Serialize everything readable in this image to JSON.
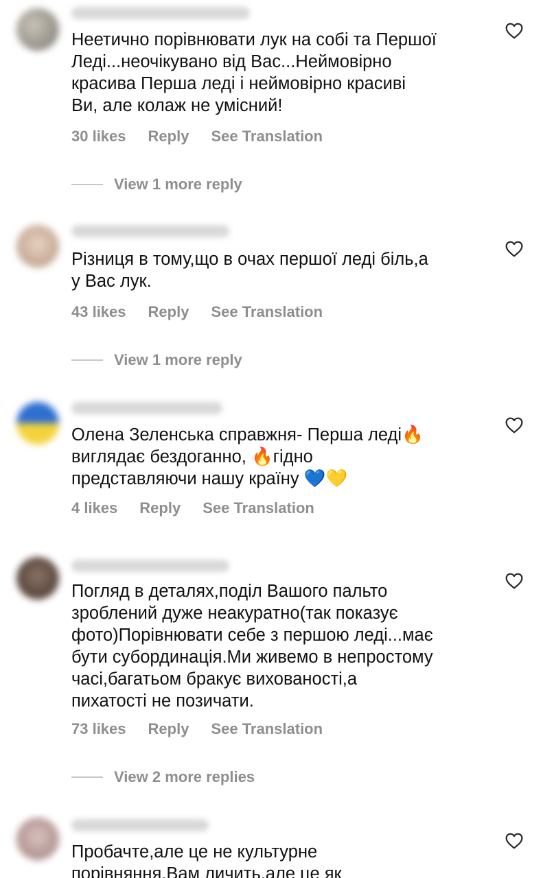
{
  "comments": [
    {
      "lines": [
        "Неетично порівнювати лук на собі та Першої",
        "Леді...неочікувано від Вас...Неймовірно",
        "красива Перша леді і неймовірно красиві",
        "Ви, але колаж не умісний!"
      ],
      "likes": "30 likes",
      "reply": "Reply",
      "translate": "See Translation",
      "more_replies": "View 1 more reply"
    },
    {
      "lines": [
        "Різниця в тому,що в очах першої леді біль,а",
        "у Вас лук."
      ],
      "likes": "43 likes",
      "reply": "Reply",
      "translate": "See Translation",
      "more_replies": "View 1 more reply"
    },
    {
      "lines": [
        "Олена Зеленська  справжня-  Перша леді",
        "виглядає бездоганно, ",
        "гідно",
        "представляючи нашу  країну "
      ],
      "emoji_fire": "🔥",
      "emoji_blue_heart": "💙",
      "emoji_yellow_heart": "💛",
      "likes": "4 likes",
      "reply": "Reply",
      "translate": "See Translation"
    },
    {
      "lines": [
        "Погляд в деталях,поділ Вашого пальто",
        "зроблений дуже неакуратно(так показує",
        "фото)Порівнювати себе з першою леді...має",
        "бути субординація.Ми живемо в непростому",
        "часі,багатьом бракує вихованості,а",
        "пихатості не позичати."
      ],
      "likes": "73 likes",
      "reply": "Reply",
      "translate": "See Translation",
      "more_replies": "View 2 more replies"
    },
    {
      "lines": [
        "Пробачте,але це не культурне",
        "порівняння.Вам личить,але це як"
      ]
    }
  ],
  "icons": {
    "like": "heart-outline-icon"
  },
  "colors": {
    "text": "#111111",
    "meta": "#8e8e8e",
    "dash": "#c7c7c7"
  }
}
